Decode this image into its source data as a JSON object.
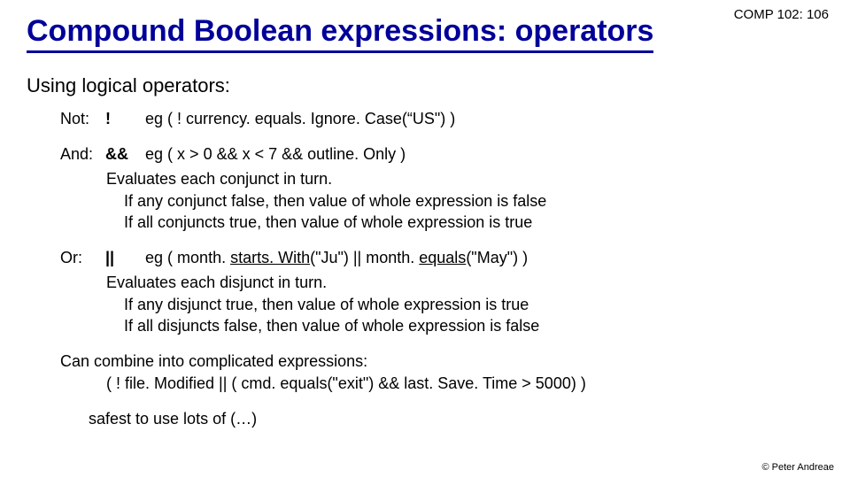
{
  "course_tag": "COMP 102: 106",
  "title": "Compound Boolean expressions: operators",
  "subhead": "Using logical operators:",
  "not": {
    "label": "Not:",
    "sym": "!",
    "eg_pre": "eg   ( ! currency. equals. Ignore. Case(",
    "eg_q1": "“",
    "eg_mid": "US\") )"
  },
  "and": {
    "label": "And:",
    "sym": "&&",
    "eg": "eg  ( x > 0  &&  x < 7  &&  outline. Only )",
    "l1": "Evaluates each conjunct in turn.",
    "l2": "If any conjunct false, then value of whole expression is false",
    "l3": "If all conjuncts true, then value of whole expression is true"
  },
  "or": {
    "label": "Or:",
    "sym": "||",
    "eg_pre": "eg ( month. ",
    "eg_u1": "starts. With",
    "eg_mid1": "(\"Ju\")  ||  month. ",
    "eg_u2": "equals",
    "eg_post": "(\"May\") )",
    "l1": "Evaluates each disjunct in turn.",
    "l2": "If any disjunct true, then value of whole expression is true",
    "l3": "If all disjuncts false, then value of whole expression is false"
  },
  "combine": {
    "head": "Can combine into complicated expressions:",
    "expr": "( ! file. Modified   ||   (  cmd. equals(\"exit\")  &&    last. Save. Time > 5000) )"
  },
  "safest": "safest to use lots of (…)",
  "copyright": "© Peter Andreae"
}
